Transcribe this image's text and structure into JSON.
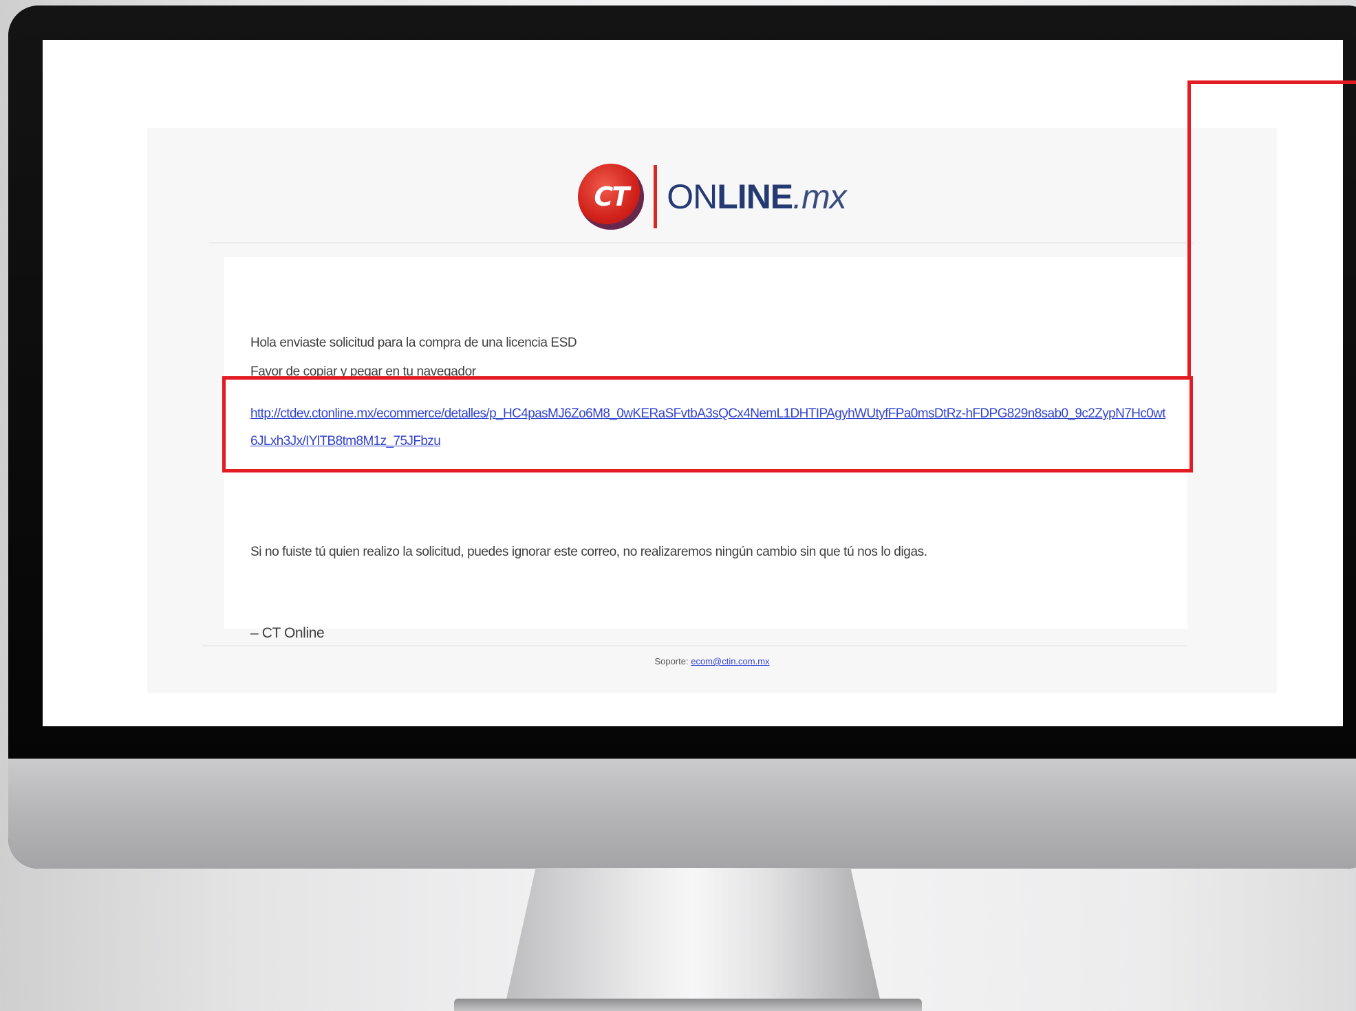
{
  "brand": {
    "logo_mark": "CT",
    "logo_word_prefix": "ON",
    "logo_word_bold": "LINE",
    "logo_word_suffix": ".mx"
  },
  "email": {
    "greeting": "Hola enviaste solicitud para la compra de una licencia ESD",
    "instruction": "Favor de copiar y pegar en tu navegador",
    "link": "http://ctdev.ctonline.mx/ecommerce/detalles/p_HC4pasMJ6Zo6M8_0wKERaSFvtbA3sQCx4NemL1DHTIPAgyhWUtyfFPa0msDtRz-hFDPG829n8sab0_9c2ZypN7Hc0wt6JLxh3Jx/IYlTB8tm8M1z_75JFbzu",
    "warning": "Si no fuiste tú quien realizo la solicitud, puedes ignorar este correo, no realizaremos ningún cambio sin que tú nos lo digas.",
    "signature": "– CT Online",
    "footer_label": "Soporte:",
    "footer_email": "ecom@ctin.com.mx"
  },
  "colors": {
    "annotation": "#e31b23",
    "link": "#3344cc",
    "brand_navy": "#253a73"
  }
}
